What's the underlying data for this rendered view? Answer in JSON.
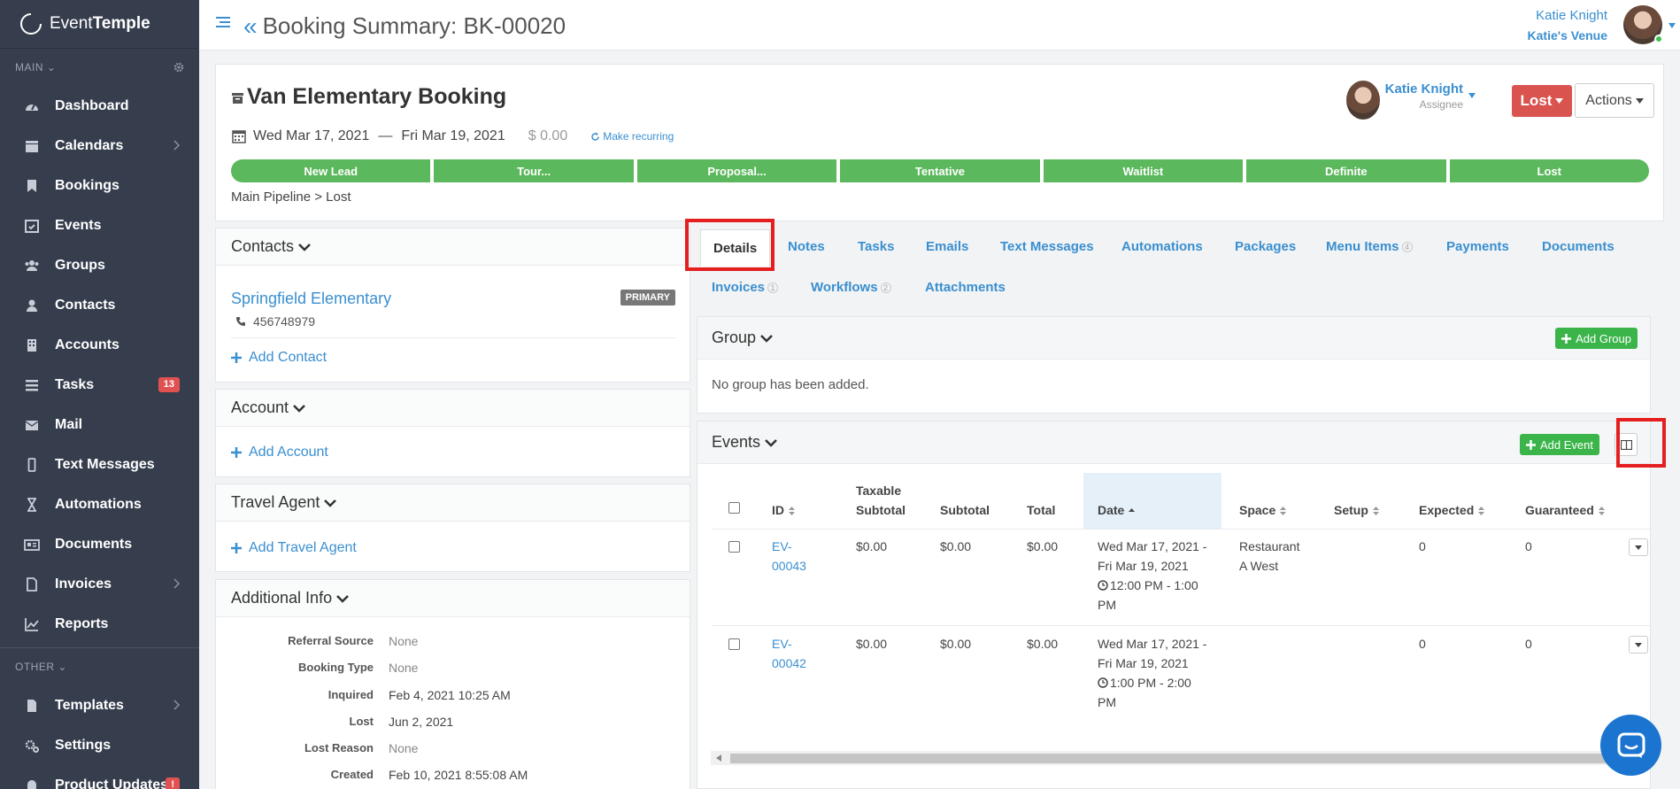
{
  "app": {
    "brand_light": "Event",
    "brand_bold": "Temple"
  },
  "sidebar": {
    "main_label": "MAIN",
    "other_label": "OTHER",
    "items": [
      {
        "label": "Dashboard",
        "icon": "dashboard-icon"
      },
      {
        "label": "Calendars",
        "icon": "calendar-icon",
        "chevron": true
      },
      {
        "label": "Bookings",
        "icon": "bookmark-icon"
      },
      {
        "label": "Events",
        "icon": "calendar-check-icon"
      },
      {
        "label": "Groups",
        "icon": "groups-icon"
      },
      {
        "label": "Contacts",
        "icon": "user-icon"
      },
      {
        "label": "Accounts",
        "icon": "building-icon"
      },
      {
        "label": "Tasks",
        "icon": "list-icon",
        "badge": "13"
      },
      {
        "label": "Mail",
        "icon": "mail-icon"
      },
      {
        "label": "Text Messages",
        "icon": "mobile-icon"
      },
      {
        "label": "Automations",
        "icon": "hourglass-icon"
      },
      {
        "label": "Documents",
        "icon": "newspaper-icon"
      },
      {
        "label": "Invoices",
        "icon": "file-icon",
        "chevron": true
      },
      {
        "label": "Reports",
        "icon": "chart-icon"
      }
    ],
    "other_items": [
      {
        "label": "Templates",
        "icon": "file-template-icon",
        "chevron": true
      },
      {
        "label": "Settings",
        "icon": "cogs-icon"
      },
      {
        "label": "Product Updates",
        "icon": "bell-icon",
        "badge": "!"
      }
    ]
  },
  "header": {
    "title": "Booking Summary: BK-00020",
    "user_name": "Katie Knight",
    "venue": "Katie's Venue"
  },
  "booking": {
    "name": "Van Elementary Booking",
    "start_date": "Wed Mar 17, 2021",
    "dash": "—",
    "end_date": "Fri Mar 19, 2021",
    "amount": "$ 0.00",
    "recurring_label": "Make recurring",
    "assignee_name": "Katie Knight",
    "assignee_role": "Assignee",
    "status": "Lost",
    "actions_label": "Actions",
    "stages": [
      "New Lead",
      "Tour...",
      "Proposal...",
      "Tentative",
      "Waitlist",
      "Definite",
      "Lost"
    ],
    "breadcrumb": "Main Pipeline > Lost"
  },
  "contacts": {
    "title": "Contacts",
    "name": "Springfield Elementary",
    "phone": "456748979",
    "badge": "PRIMARY",
    "add_label": "Add Contact"
  },
  "account": {
    "title": "Account",
    "add_label": "Add Account"
  },
  "travel_agent": {
    "title": "Travel Agent",
    "add_label": "Add Travel Agent"
  },
  "additional_info": {
    "title": "Additional Info",
    "rows": [
      {
        "key": "Referral Source",
        "value": "None"
      },
      {
        "key": "Booking Type",
        "value": "None"
      },
      {
        "key": "Inquired",
        "value": "Feb 4, 2021 10:25 AM"
      },
      {
        "key": "Lost",
        "value": "Jun 2, 2021"
      },
      {
        "key": "Lost Reason",
        "value": "None"
      },
      {
        "key": "Created",
        "value": "Feb 10, 2021 8:55:08 AM"
      }
    ]
  },
  "tabs": {
    "details": "Details",
    "notes": "Notes",
    "tasks": "Tasks",
    "emails": "Emails",
    "text_messages": "Text Messages",
    "automations": "Automations",
    "packages": "Packages",
    "menu_items": "Menu Items",
    "menu_items_count": "4",
    "payments": "Payments",
    "documents": "Documents",
    "invoices": "Invoices",
    "invoices_count": "1",
    "workflows": "Workflows",
    "workflows_count": "2",
    "attachments": "Attachments"
  },
  "group": {
    "title": "Group",
    "add_label": "Add Group",
    "empty": "No group has been added."
  },
  "events": {
    "title": "Events",
    "add_label": "Add Event",
    "columns": {
      "id": "ID",
      "taxable_1": "Taxable",
      "taxable_2": "Subtotal",
      "subtotal": "Subtotal",
      "total": "Total",
      "date": "Date",
      "space": "Space",
      "setup": "Setup",
      "expected": "Expected",
      "guaranteed": "Guaranteed"
    },
    "rows": [
      {
        "id_1": "EV-",
        "id_2": "00043",
        "taxable": "$0.00",
        "subtotal": "$0.00",
        "total": "$0.00",
        "date_1": "Wed Mar 17, 2021 -",
        "date_2": "Fri Mar 19, 2021",
        "time_1": "12:00 PM - 1:00",
        "time_2": "PM",
        "space_1": "Restaurant",
        "space_2": "A West",
        "setup": "",
        "expected": "0",
        "guaranteed": "0"
      },
      {
        "id_1": "EV-",
        "id_2": "00042",
        "taxable": "$0.00",
        "subtotal": "$0.00",
        "total": "$0.00",
        "date_1": "Wed Mar 17, 2021 -",
        "date_2": "Fri Mar 19, 2021",
        "time_1": "1:00 PM - 2:00",
        "time_2": "PM",
        "space_1": "",
        "space_2": "",
        "setup": "",
        "expected": "0",
        "guaranteed": "0"
      }
    ]
  },
  "colors": {
    "sidebar": "#363d4d",
    "accent": "#3a8fd0",
    "stage_green": "#5cb85c",
    "lost_red": "#d9534f",
    "add_green": "#3bb54a",
    "highlight": "#e51f1f"
  }
}
